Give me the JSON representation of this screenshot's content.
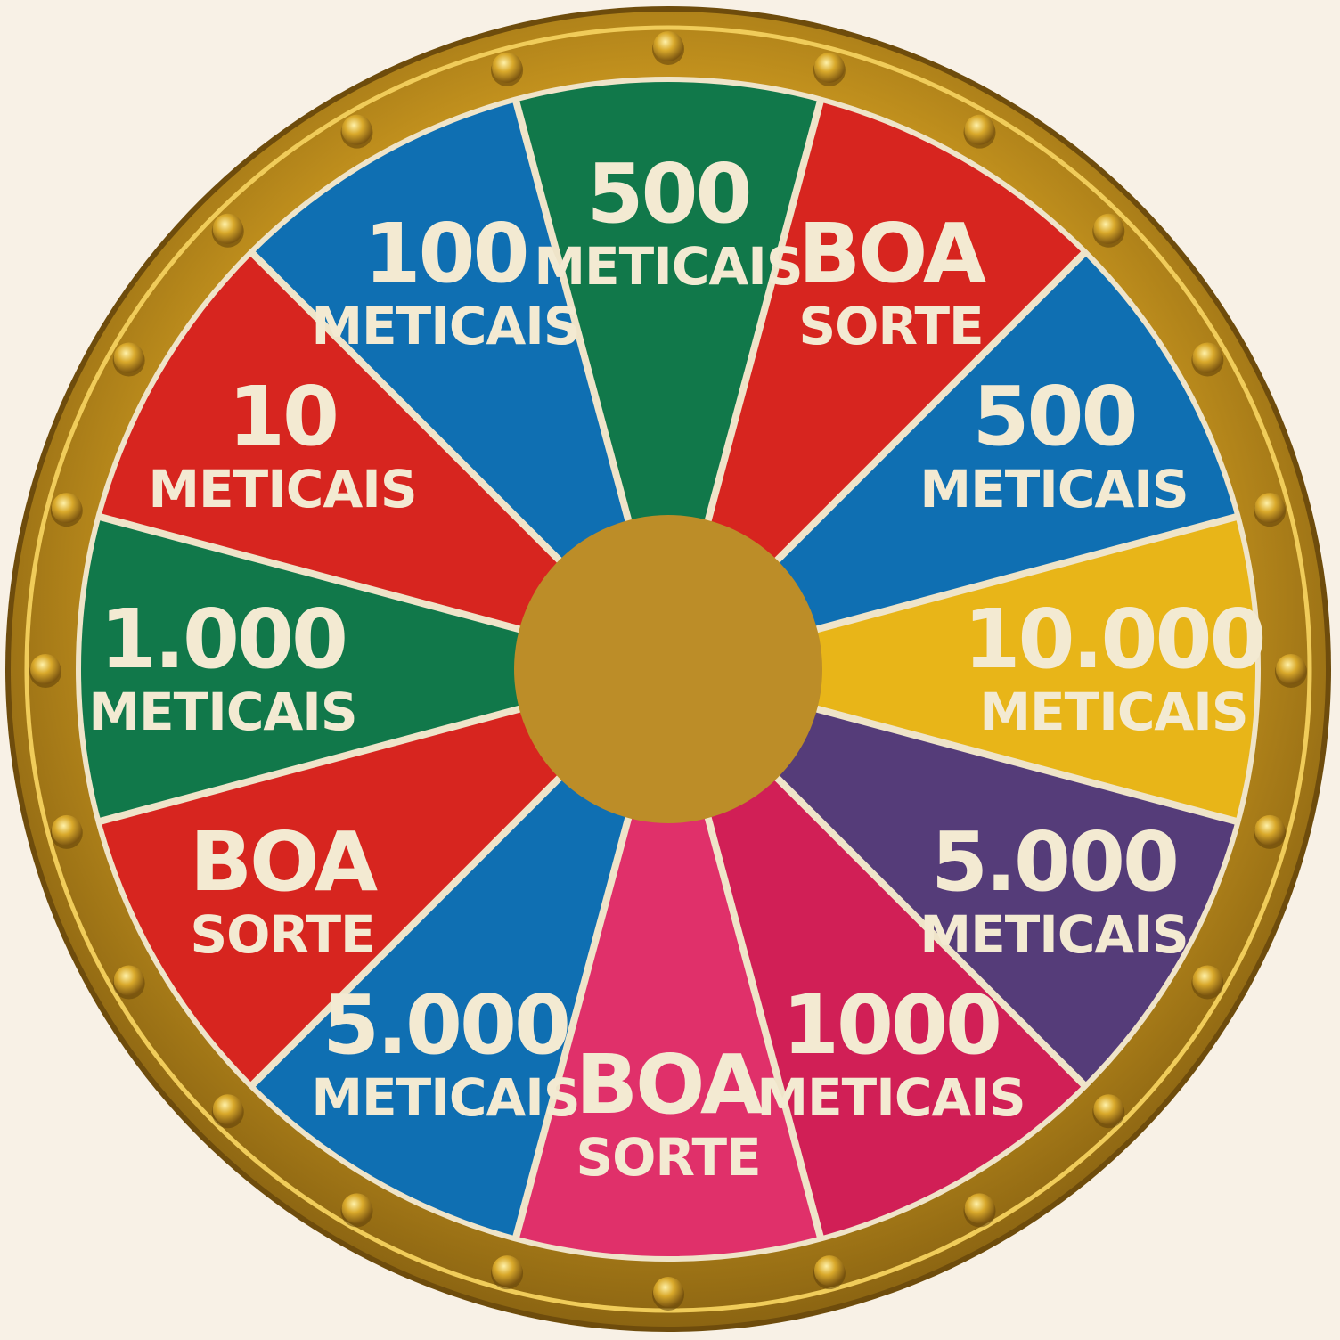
{
  "wheel": {
    "hub_color": "#bc8d28",
    "rim_color": "#c9961f",
    "divider_color": "#efe4c9",
    "text_color": "#f3ead2",
    "segments": [
      {
        "line1": "500",
        "line2": "METICAIS",
        "color": "#11784a"
      },
      {
        "line1": "BOA",
        "line2": "SORTE",
        "color": "#d7251f"
      },
      {
        "line1": "500",
        "line2": "METICAIS",
        "color": "#0f6fb2"
      },
      {
        "line1": "10.000",
        "line2": "METICAIS",
        "color": "#e8b518"
      },
      {
        "line1": "5.000",
        "line2": "METICAIS",
        "color": "#553c79"
      },
      {
        "line1": "1000",
        "line2": "METICAIS",
        "color": "#d11f56"
      },
      {
        "line1": "BOA",
        "line2": "SORTE",
        "color": "#e0306a"
      },
      {
        "line1": "5.000",
        "line2": "METICAIS",
        "color": "#0f6fb2"
      },
      {
        "line1": "BOA",
        "line2": "SORTE",
        "color": "#d7251f"
      },
      {
        "line1": "1.000",
        "line2": "METICAIS",
        "color": "#11784a"
      },
      {
        "line1": "10",
        "line2": "METICAIS",
        "color": "#d7251f"
      },
      {
        "line1": "100",
        "line2": "METICAIS",
        "color": "#0f6fb2"
      }
    ]
  }
}
